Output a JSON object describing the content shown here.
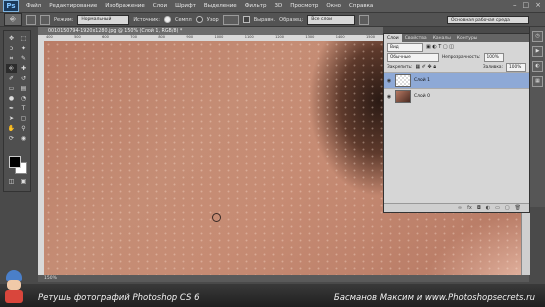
{
  "menu": {
    "logo": "Ps",
    "items": [
      "Файл",
      "Редактирование",
      "Изображение",
      "Слои",
      "Шрифт",
      "Выделение",
      "Фильтр",
      "3D",
      "Просмотр",
      "Окно",
      "Справка"
    ],
    "window_controls": [
      "–",
      "□",
      "×"
    ]
  },
  "options": {
    "mode_label": "Режим:",
    "mode_value": "Нормальный",
    "source_label": "Источник:",
    "source_option_1": "Семпл",
    "source_option_2": "Узор",
    "aligned_label": "Выравн.",
    "sample_label": "Образец:",
    "sample_value": "Все слои",
    "workspace": "Основная рабочая среда"
  },
  "document": {
    "tab_title": "0010150794-1920x1280.jpg @ 150% (Слой 1, RGB/8) *",
    "ruler_marks": [
      "400",
      "450",
      "500",
      "550",
      "600",
      "650",
      "700",
      "750",
      "800",
      "850",
      "900",
      "950",
      "1000",
      "1050",
      "1100",
      "1150",
      "1200",
      "1250",
      "1300",
      "1350",
      "1400",
      "1450",
      "1500"
    ],
    "status": "150%"
  },
  "layers_panel": {
    "tabs": [
      "Слои",
      "Свойства",
      "Каналы",
      "Контуры"
    ],
    "filter_value": "Вид",
    "blend_mode": "Обычные",
    "opacity_label": "Непрозрачность:",
    "opacity_value": "100%",
    "lock_label": "Закрепить:",
    "fill_label": "Заливка:",
    "fill_value": "100%",
    "layers": [
      {
        "name": "Слой 1",
        "selected": true
      },
      {
        "name": "Слой 0",
        "selected": false
      }
    ],
    "footer_icons": [
      "link-icon",
      "fx-icon",
      "mask-icon",
      "adjustment-icon",
      "folder-icon",
      "new-layer-icon",
      "trash-icon"
    ]
  },
  "caption": {
    "left": "Ретушь фотографий   Photoshop CS 6",
    "right": "Басманов Максим и www.Photoshopsecrets.ru"
  },
  "colors": {
    "selected_layer": "#8ea9d6",
    "foreground": "#000000",
    "background": "#ffffff"
  }
}
